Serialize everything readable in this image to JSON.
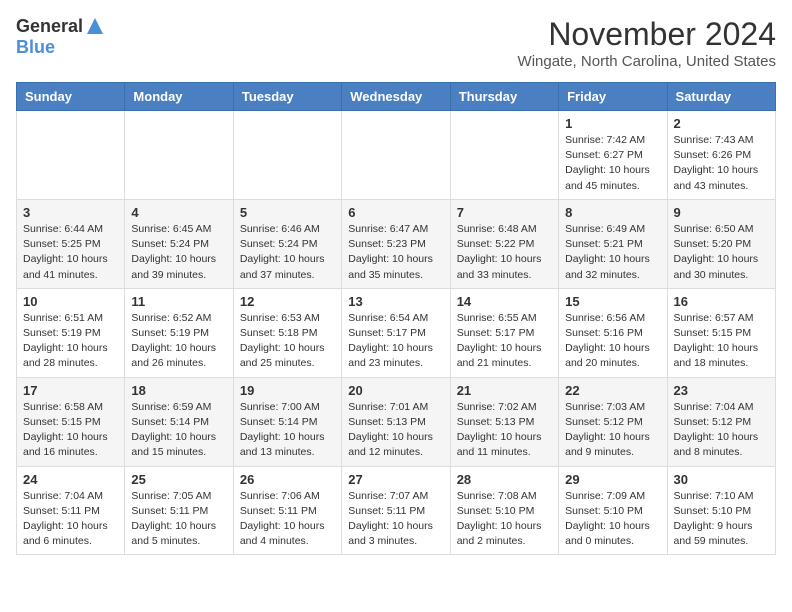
{
  "header": {
    "logo_general": "General",
    "logo_blue": "Blue",
    "title": "November 2024",
    "location": "Wingate, North Carolina, United States"
  },
  "days_of_week": [
    "Sunday",
    "Monday",
    "Tuesday",
    "Wednesday",
    "Thursday",
    "Friday",
    "Saturday"
  ],
  "weeks": [
    [
      {
        "day": "",
        "info": ""
      },
      {
        "day": "",
        "info": ""
      },
      {
        "day": "",
        "info": ""
      },
      {
        "day": "",
        "info": ""
      },
      {
        "day": "",
        "info": ""
      },
      {
        "day": "1",
        "info": "Sunrise: 7:42 AM\nSunset: 6:27 PM\nDaylight: 10 hours\nand 45 minutes."
      },
      {
        "day": "2",
        "info": "Sunrise: 7:43 AM\nSunset: 6:26 PM\nDaylight: 10 hours\nand 43 minutes."
      }
    ],
    [
      {
        "day": "3",
        "info": "Sunrise: 6:44 AM\nSunset: 5:25 PM\nDaylight: 10 hours\nand 41 minutes."
      },
      {
        "day": "4",
        "info": "Sunrise: 6:45 AM\nSunset: 5:24 PM\nDaylight: 10 hours\nand 39 minutes."
      },
      {
        "day": "5",
        "info": "Sunrise: 6:46 AM\nSunset: 5:24 PM\nDaylight: 10 hours\nand 37 minutes."
      },
      {
        "day": "6",
        "info": "Sunrise: 6:47 AM\nSunset: 5:23 PM\nDaylight: 10 hours\nand 35 minutes."
      },
      {
        "day": "7",
        "info": "Sunrise: 6:48 AM\nSunset: 5:22 PM\nDaylight: 10 hours\nand 33 minutes."
      },
      {
        "day": "8",
        "info": "Sunrise: 6:49 AM\nSunset: 5:21 PM\nDaylight: 10 hours\nand 32 minutes."
      },
      {
        "day": "9",
        "info": "Sunrise: 6:50 AM\nSunset: 5:20 PM\nDaylight: 10 hours\nand 30 minutes."
      }
    ],
    [
      {
        "day": "10",
        "info": "Sunrise: 6:51 AM\nSunset: 5:19 PM\nDaylight: 10 hours\nand 28 minutes."
      },
      {
        "day": "11",
        "info": "Sunrise: 6:52 AM\nSunset: 5:19 PM\nDaylight: 10 hours\nand 26 minutes."
      },
      {
        "day": "12",
        "info": "Sunrise: 6:53 AM\nSunset: 5:18 PM\nDaylight: 10 hours\nand 25 minutes."
      },
      {
        "day": "13",
        "info": "Sunrise: 6:54 AM\nSunset: 5:17 PM\nDaylight: 10 hours\nand 23 minutes."
      },
      {
        "day": "14",
        "info": "Sunrise: 6:55 AM\nSunset: 5:17 PM\nDaylight: 10 hours\nand 21 minutes."
      },
      {
        "day": "15",
        "info": "Sunrise: 6:56 AM\nSunset: 5:16 PM\nDaylight: 10 hours\nand 20 minutes."
      },
      {
        "day": "16",
        "info": "Sunrise: 6:57 AM\nSunset: 5:15 PM\nDaylight: 10 hours\nand 18 minutes."
      }
    ],
    [
      {
        "day": "17",
        "info": "Sunrise: 6:58 AM\nSunset: 5:15 PM\nDaylight: 10 hours\nand 16 minutes."
      },
      {
        "day": "18",
        "info": "Sunrise: 6:59 AM\nSunset: 5:14 PM\nDaylight: 10 hours\nand 15 minutes."
      },
      {
        "day": "19",
        "info": "Sunrise: 7:00 AM\nSunset: 5:14 PM\nDaylight: 10 hours\nand 13 minutes."
      },
      {
        "day": "20",
        "info": "Sunrise: 7:01 AM\nSunset: 5:13 PM\nDaylight: 10 hours\nand 12 minutes."
      },
      {
        "day": "21",
        "info": "Sunrise: 7:02 AM\nSunset: 5:13 PM\nDaylight: 10 hours\nand 11 minutes."
      },
      {
        "day": "22",
        "info": "Sunrise: 7:03 AM\nSunset: 5:12 PM\nDaylight: 10 hours\nand 9 minutes."
      },
      {
        "day": "23",
        "info": "Sunrise: 7:04 AM\nSunset: 5:12 PM\nDaylight: 10 hours\nand 8 minutes."
      }
    ],
    [
      {
        "day": "24",
        "info": "Sunrise: 7:04 AM\nSunset: 5:11 PM\nDaylight: 10 hours\nand 6 minutes."
      },
      {
        "day": "25",
        "info": "Sunrise: 7:05 AM\nSunset: 5:11 PM\nDaylight: 10 hours\nand 5 minutes."
      },
      {
        "day": "26",
        "info": "Sunrise: 7:06 AM\nSunset: 5:11 PM\nDaylight: 10 hours\nand 4 minutes."
      },
      {
        "day": "27",
        "info": "Sunrise: 7:07 AM\nSunset: 5:11 PM\nDaylight: 10 hours\nand 3 minutes."
      },
      {
        "day": "28",
        "info": "Sunrise: 7:08 AM\nSunset: 5:10 PM\nDaylight: 10 hours\nand 2 minutes."
      },
      {
        "day": "29",
        "info": "Sunrise: 7:09 AM\nSunset: 5:10 PM\nDaylight: 10 hours\nand 0 minutes."
      },
      {
        "day": "30",
        "info": "Sunrise: 7:10 AM\nSunset: 5:10 PM\nDaylight: 9 hours\nand 59 minutes."
      }
    ]
  ]
}
